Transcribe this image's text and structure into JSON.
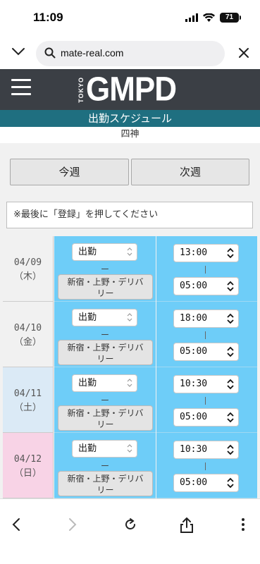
{
  "status_bar": {
    "time": "11:09",
    "battery": "71"
  },
  "browser": {
    "url": "mate-real.com"
  },
  "header": {
    "logo_small": "TOKYO",
    "logo_big": "GMPD"
  },
  "page": {
    "title": "出勤スケジュール",
    "subtitle": "四神"
  },
  "week_nav": {
    "this_week": "今週",
    "next_week": "次週"
  },
  "notice": "※最後に「登録」を押してください",
  "schedule": [
    {
      "date": "04/09",
      "dow": "（木）",
      "status": "出勤",
      "separator": "ー",
      "area_line1": "新宿・上野・デリバ",
      "area_line2": "リー",
      "start": "13:00",
      "end": "05:00",
      "date_bg": "#f1f1f1"
    },
    {
      "date": "04/10",
      "dow": "（金）",
      "status": "出勤",
      "separator": "ー",
      "area_line1": "新宿・上野・デリバ",
      "area_line2": "リー",
      "start": "18:00",
      "end": "05:00",
      "date_bg": "#f1f1f1"
    },
    {
      "date": "04/11",
      "dow": "（土）",
      "status": "出勤",
      "separator": "ー",
      "area_line1": "新宿・上野・デリバ",
      "area_line2": "リー",
      "start": "10:30",
      "end": "05:00",
      "date_bg": "#dbeaf6"
    },
    {
      "date": "04/12",
      "dow": "（日）",
      "status": "出勤",
      "separator": "ー",
      "area_line1": "新宿・上野・デリバ",
      "area_line2": "リー",
      "start": "10:30",
      "end": "05:00",
      "date_bg": "#f8d3e6"
    }
  ],
  "colors": {
    "header_bg": "#3b3f45",
    "title_bar": "#1f6f80",
    "shift_cell": "#6ecdf8"
  }
}
